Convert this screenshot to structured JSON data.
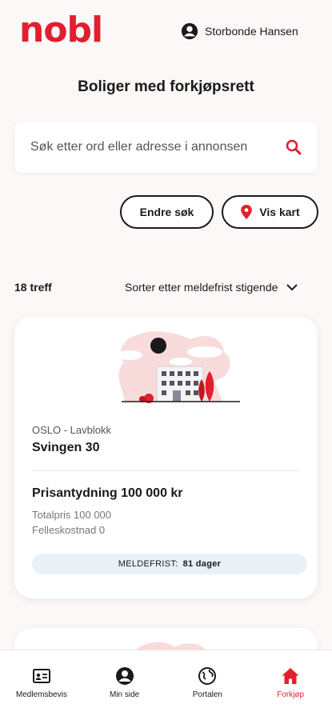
{
  "header": {
    "logo": "nobl",
    "user_name": "Storbonde Hansen"
  },
  "page": {
    "title": "Boliger med forkjøpsrett"
  },
  "search": {
    "placeholder": "Søk etter ord eller adresse i annonsen"
  },
  "actions": {
    "edit_search": "Endre søk",
    "show_map": "Vis kart"
  },
  "results": {
    "count_label": "18 treff",
    "sort_label": "Sorter etter meldefrist stigende"
  },
  "listing": {
    "location": "OSLO - Lavblokk",
    "address": "Svingen 30",
    "price": "Prisantydning 100 000 kr",
    "total_price": "Totalpris 100 000",
    "shared_cost": "Felleskostnad 0",
    "deadline_label": "MELDEFRIST:",
    "deadline_value": "81 dager"
  },
  "nav": {
    "items": [
      {
        "label": "Medlemsbevis",
        "icon": "id-card-icon"
      },
      {
        "label": "Min side",
        "icon": "user-circle-icon"
      },
      {
        "label": "Portalen",
        "icon": "globe-icon"
      },
      {
        "label": "Forkjøp",
        "icon": "home-icon"
      }
    ],
    "active": "Forkjøp"
  },
  "colors": {
    "brand": "#e0202e",
    "background": "#fcf8f8",
    "deadline_bg": "#e9f1f8"
  }
}
